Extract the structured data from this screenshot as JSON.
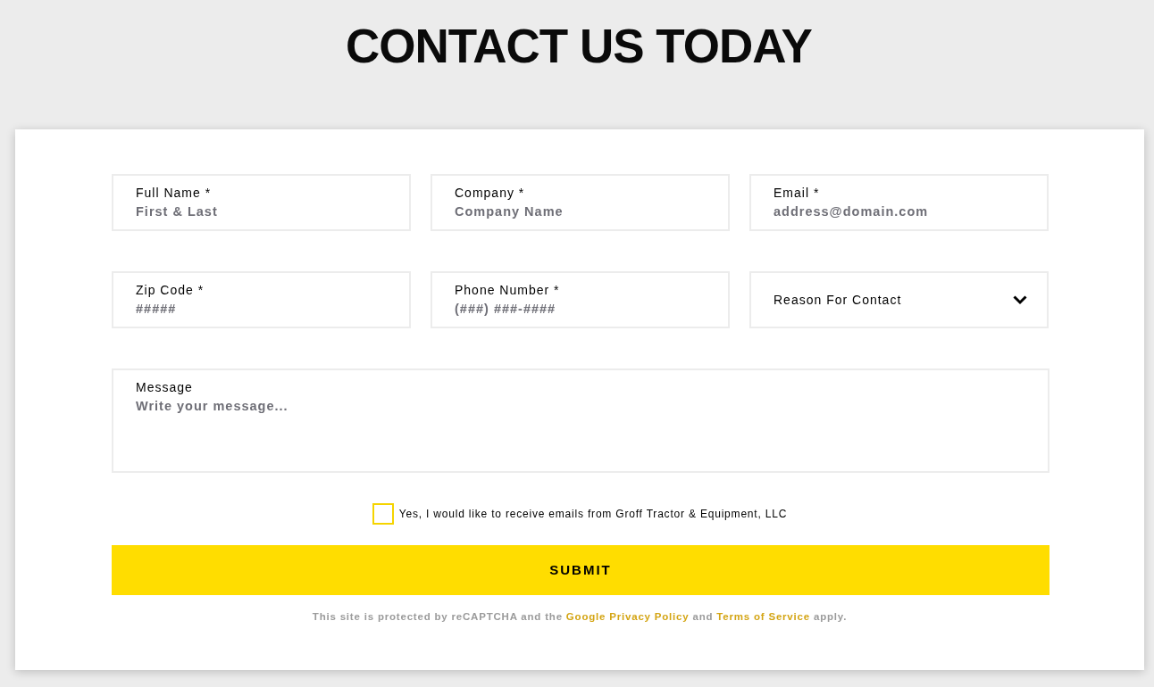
{
  "heading": "CONTACT US TODAY",
  "fields": [
    {
      "kind": "text",
      "label": "Full Name *",
      "placeholder": "First & Last"
    },
    {
      "kind": "text",
      "label": "Company *",
      "placeholder": "Company Name"
    },
    {
      "kind": "text",
      "label": "Email *",
      "placeholder": "address@domain.com"
    },
    {
      "kind": "text",
      "label": "Zip Code *",
      "placeholder": "#####"
    },
    {
      "kind": "text",
      "label": "Phone Number *",
      "placeholder": "(###) ###-####"
    },
    {
      "kind": "select",
      "label": "Reason For Contact"
    }
  ],
  "message": {
    "label": "Message",
    "placeholder": "Write your message..."
  },
  "consent": {
    "label": "Yes, I would like to receive emails from Groff Tractor & Equipment, LLC",
    "checked": false
  },
  "submit": "SUBMIT",
  "recaptcha_notice": [
    {
      "kind": "text",
      "text": "This site is protected by reCAPTCHA and the"
    },
    {
      "kind": "link",
      "text": "Google Privacy Policy"
    },
    {
      "kind": "text",
      "text": "and"
    },
    {
      "kind": "link",
      "text": "Terms of Service"
    },
    {
      "kind": "text",
      "text": "apply."
    }
  ]
}
